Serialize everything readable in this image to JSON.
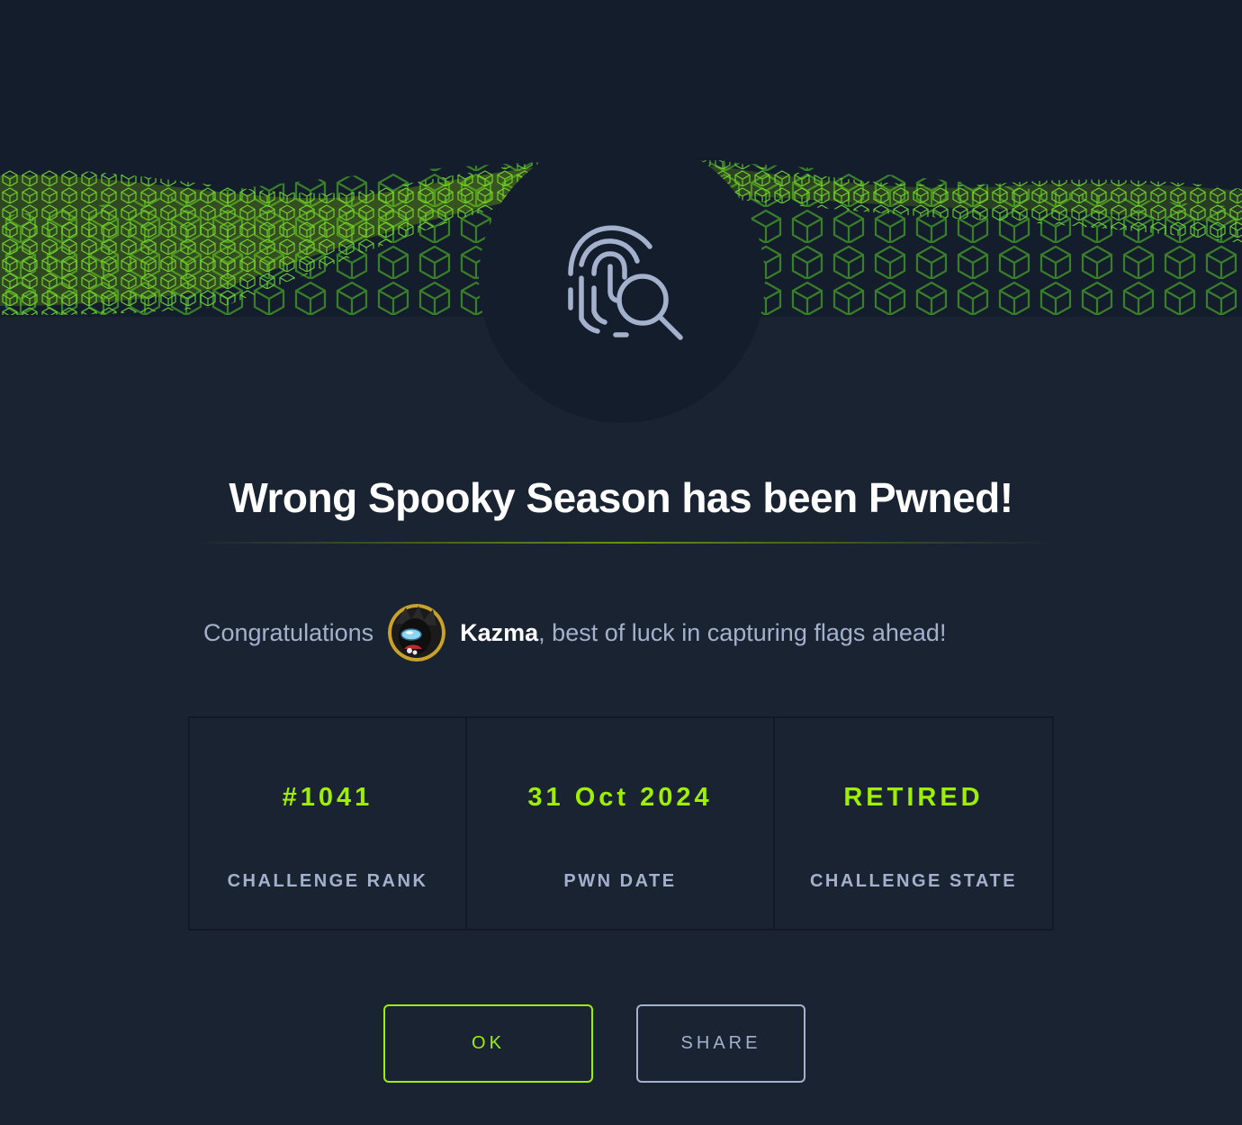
{
  "banner": {
    "accent_color": "#9fef00",
    "pattern": "green-hex-cube-wave"
  },
  "badge": {
    "icon": "fingerprint-search-icon"
  },
  "title": "Wrong Spooky Season has been Pwned!",
  "congrats": {
    "prefix": "Congratulations",
    "username": "Kazma",
    "suffix": ", best of luck in capturing flags ahead!"
  },
  "stats": [
    {
      "value": "#1041",
      "label": "CHALLENGE RANK"
    },
    {
      "value": "31 Oct 2024",
      "label": "PWN DATE"
    },
    {
      "value": "RETIRED",
      "label": "CHALLENGE STATE"
    }
  ],
  "buttons": {
    "ok_label": "OK",
    "share_label": "SHARE"
  },
  "colors": {
    "background": "#1a2332",
    "top_band": "#141d2b",
    "accent": "#9fef00",
    "muted_text": "#a4b1cd"
  }
}
